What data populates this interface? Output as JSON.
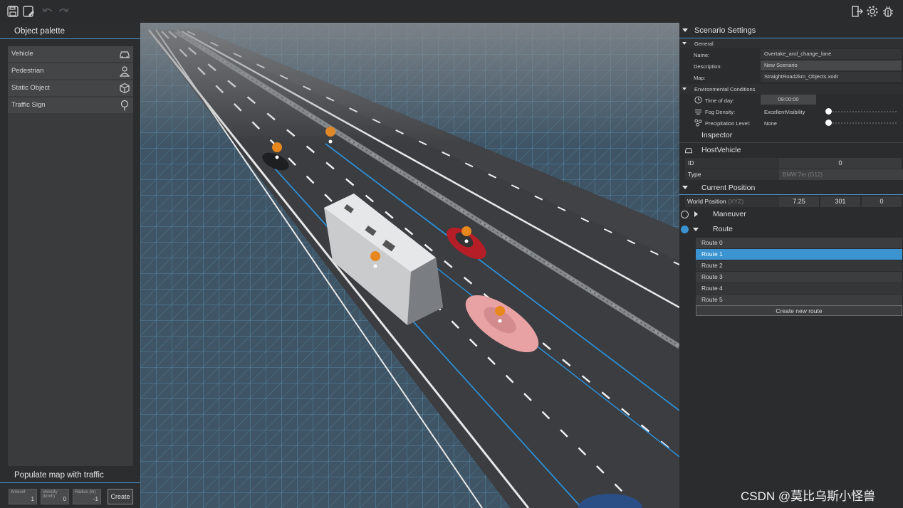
{
  "toolbar": {
    "icons": [
      "save-icon",
      "save-as-icon",
      "undo-icon",
      "redo-icon",
      "export-icon",
      "gear-icon",
      "bug-icon"
    ]
  },
  "palette": {
    "title": "Object palette",
    "items": [
      {
        "label": "Vehicle",
        "icon": "car-icon"
      },
      {
        "label": "Pedestrian",
        "icon": "person-icon"
      },
      {
        "label": "Static Object",
        "icon": "cube-icon"
      },
      {
        "label": "Traffic Sign",
        "icon": "pin-icon"
      }
    ]
  },
  "traffic": {
    "title": "Populate map with traffic",
    "fields": [
      {
        "label": "Amount",
        "value": "1"
      },
      {
        "label": "Velocity (km/h)",
        "value": "0"
      },
      {
        "label": "Radius (m)",
        "value": "-1"
      }
    ],
    "create_label": "Create"
  },
  "scenario": {
    "title": "Scenario Settings",
    "general_title": "General",
    "general": [
      {
        "key": "Name:",
        "value": "Overtake_and_change_lane"
      },
      {
        "key": "Description:",
        "value": "New Scenario"
      },
      {
        "key": "Map:",
        "value": "StraightRoad2km_Objects.xodr"
      }
    ],
    "env_title": "Environmental Conditions",
    "env": [
      {
        "key": "Time of day:",
        "value": "09:00:00",
        "icon": "clock-icon"
      },
      {
        "key": "Fog Density:",
        "value": "ExcellentVisibility",
        "icon": "fog-icon"
      },
      {
        "key": "Precipitation Level:",
        "value": "None",
        "icon": "rain-icon"
      }
    ]
  },
  "inspector": {
    "title": "Inspector",
    "object_name": "HostVehicle",
    "id_label": "ID",
    "id_value": "0",
    "type_label": "Type",
    "type_value": "BMW 7er (G12)",
    "position_title": "Current Position",
    "world_label": "World Position",
    "world_unit": "(XYZ)",
    "world": [
      "7.25",
      "301",
      "0"
    ],
    "maneuver_label": "Maneuver",
    "route_label": "Route",
    "routes": [
      "Route 0",
      "Route 1",
      "Route 2",
      "Route 3",
      "Route 4",
      "Route 5"
    ],
    "selected_route": 1,
    "create_route_label": "Create new route"
  },
  "colors": {
    "accent": "#3b94cf",
    "marker": "#e8871e",
    "road": "#3a3c3f",
    "grid": "#4a86a6"
  },
  "watermark": "CSDN @莫比乌斯小怪兽"
}
